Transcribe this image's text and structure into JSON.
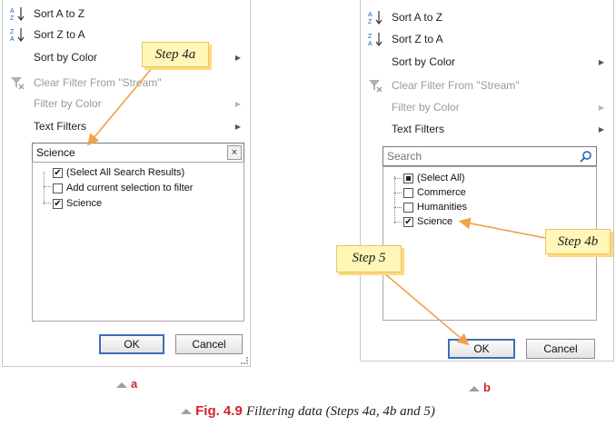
{
  "panel_a": {
    "menu": [
      {
        "label": "Sort A to Z",
        "icon": "sort-ascending-icon"
      },
      {
        "label": "Sort Z to A",
        "icon": "sort-descending-icon"
      },
      {
        "label": "Sort by Color"
      },
      {
        "label": "Clear Filter From \"Stream\"",
        "icon": "clear-filter-icon"
      },
      {
        "label": "Filter by Color"
      },
      {
        "label": "Text Filters"
      }
    ],
    "search_value": "Science",
    "clear_symbol": "×",
    "list": [
      {
        "label": "(Select All Search Results)",
        "check": "✔"
      },
      {
        "label": "Add current selection to filter",
        "check": ""
      },
      {
        "label": "Science",
        "check": "✔"
      }
    ],
    "ok_label": "OK",
    "cancel_label": "Cancel",
    "sub_label": "a"
  },
  "panel_b": {
    "menu": [
      {
        "label": "Sort A to Z",
        "icon": "sort-ascending-icon"
      },
      {
        "label": "Sort Z to A",
        "icon": "sort-descending-icon"
      },
      {
        "label": "Sort by Color"
      },
      {
        "label": "Clear Filter From \"Stream\"",
        "icon": "clear-filter-icon"
      },
      {
        "label": "Filter by Color"
      },
      {
        "label": "Text Filters"
      }
    ],
    "search_placeholder": "Search",
    "list": [
      {
        "label": "(Select All)",
        "check": ""
      },
      {
        "label": "Commerce",
        "check": ""
      },
      {
        "label": "Humanities",
        "check": ""
      },
      {
        "label": "Science",
        "check": "✔"
      }
    ],
    "ok_label": "OK",
    "cancel_label": "Cancel",
    "sub_label": "b"
  },
  "callouts": {
    "step4a": "Step 4a",
    "step4b": "Step 4b",
    "step5": "Step 5"
  },
  "caption": {
    "fig": "Fig. 4.9",
    "text": "Filtering data (Steps 4a, 4b and 5)"
  },
  "colors": {
    "accent_red": "#d2232a",
    "callout_bg": "#fff6b8",
    "arrow": "#f0a046",
    "ok_border": "#3c6fb5"
  }
}
